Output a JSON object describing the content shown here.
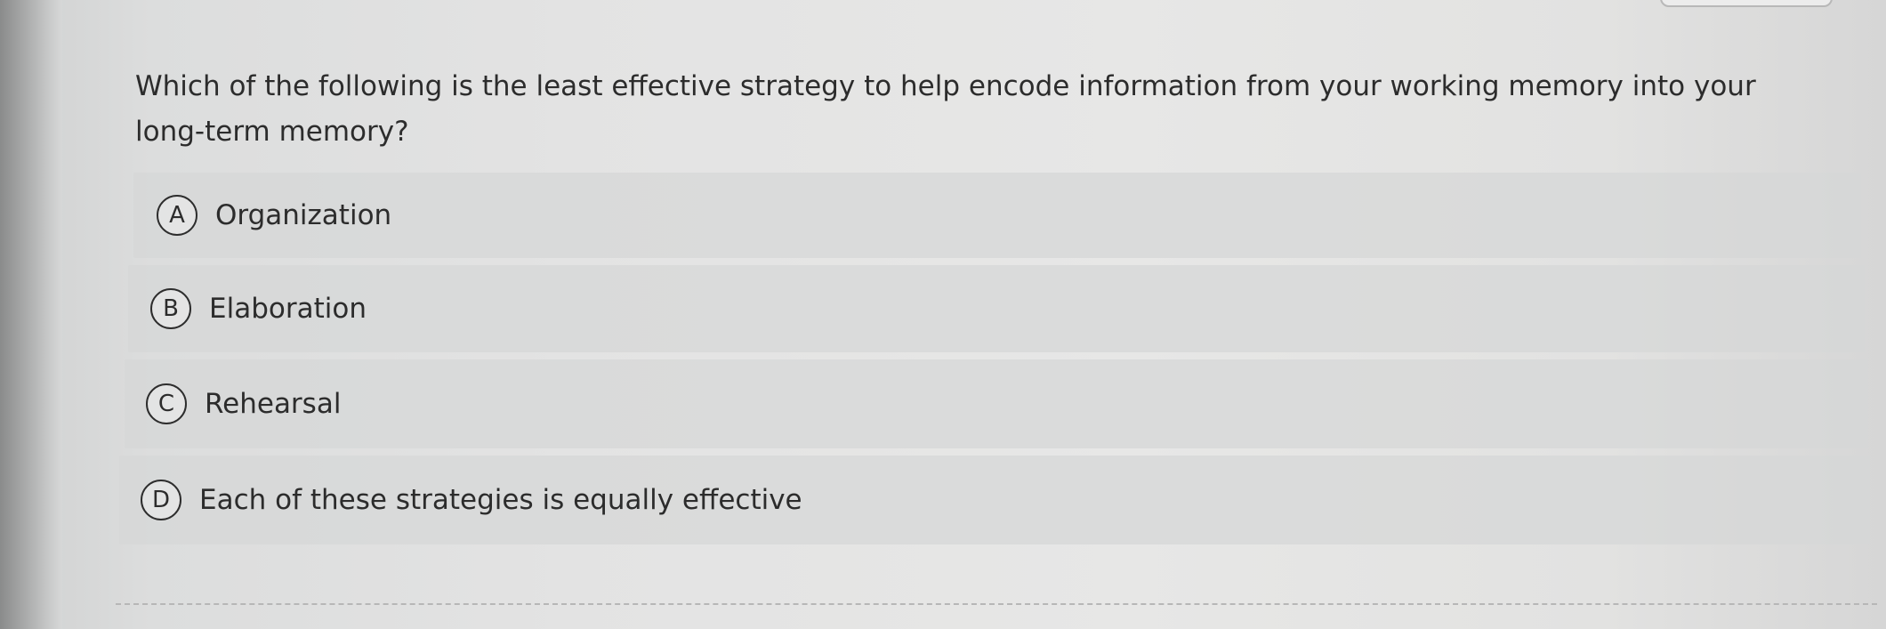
{
  "question": {
    "text": "Which of the following is the least effective strategy to help encode information from your working memory into your long-term memory?"
  },
  "options": [
    {
      "letter": "A",
      "label": "Organization"
    },
    {
      "letter": "B",
      "label": "Elaboration"
    },
    {
      "letter": "C",
      "label": "Rehearsal"
    },
    {
      "letter": "D",
      "label": "Each of these strategies is equally effective"
    }
  ]
}
